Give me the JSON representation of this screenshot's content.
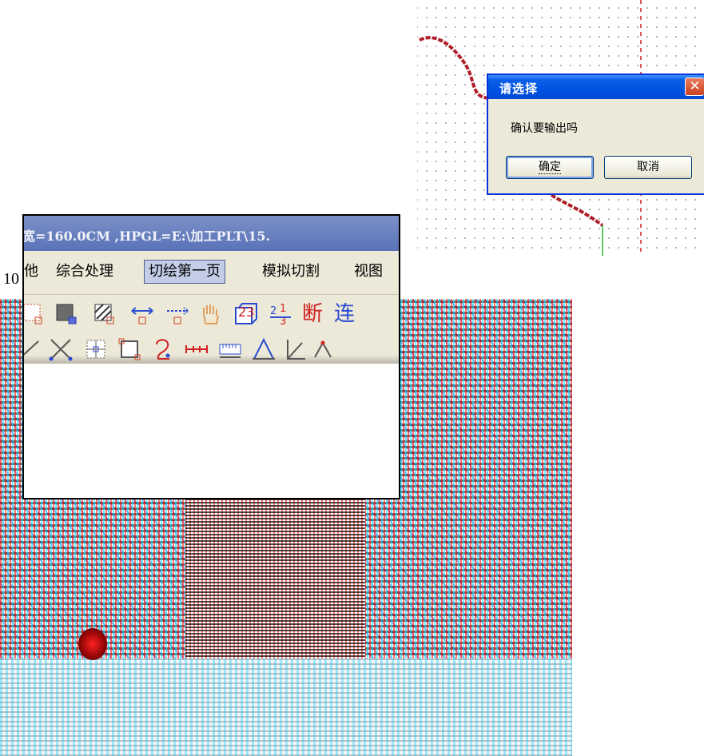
{
  "dialog": {
    "title": "请选择",
    "close_glyph": "✕",
    "message": "确认要输出吗",
    "ok_label": "确定",
    "cancel_label": "取消"
  },
  "cad_window": {
    "title_text": "宽=160.0CM ,HPGL=E:\\加工PLT\\15.",
    "menu": {
      "partial_item": "他",
      "item_general": "综合处理",
      "item_cut_first_page": "切绘第一页",
      "item_simulate_cut": "模拟切割",
      "item_view": "视图"
    },
    "toolbar_text": {
      "order_numbers": "23",
      "break_label": "断",
      "connect_label": "连"
    },
    "toolbar_icons": [
      "select-box-icon",
      "fill-pattern-icon",
      "hatch-pattern-icon",
      "move-horizontal-icon",
      "move-right-icon",
      "hand-pan-icon",
      "order-icon",
      "sequence-icon",
      "break-icon",
      "connect-icon",
      "diagonal-line-icon",
      "cross-icon",
      "grid-select-icon",
      "frame-select-icon",
      "curve-icon",
      "dimension-icon",
      "ruler-icon",
      "angle-icon",
      "corner-icon",
      "peak-icon"
    ]
  },
  "page_number": "10",
  "colors": {
    "xp_title_blue": "#0054e3",
    "dialog_face": "#ece9d8",
    "cad_title_blue": "#5a73b8",
    "path_red": "#c0202a",
    "guide_red": "#d02020",
    "guide_green": "#2fb52f"
  }
}
